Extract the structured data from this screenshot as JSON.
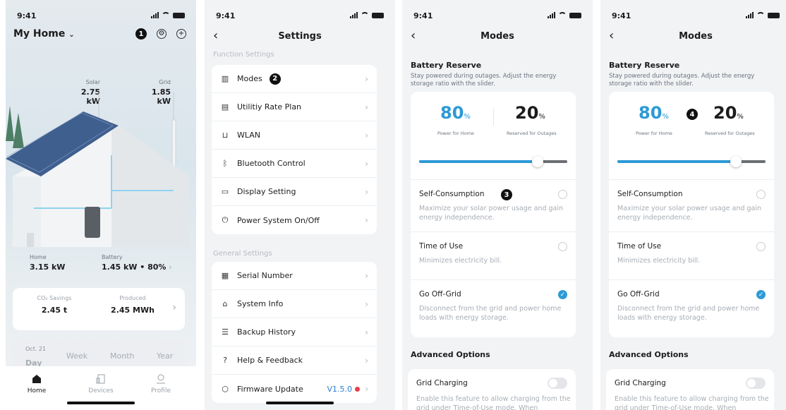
{
  "status": {
    "time": "9:41"
  },
  "home": {
    "title": "My Home",
    "badge": "1",
    "solar": {
      "label": "Solar",
      "value": "2.75 kW"
    },
    "grid": {
      "label": "Grid",
      "value": "1.85 kW"
    },
    "home_metric": {
      "label": "Home",
      "value": "3.15 kW"
    },
    "battery": {
      "label": "Battery",
      "value": "1.45 kW • 80%"
    },
    "co2": {
      "label": "CO₂ Savings",
      "value": "2.45 t"
    },
    "produced": {
      "label": "Produced",
      "value": "2.45 MWh"
    },
    "tabs": {
      "day": "Day",
      "date": "Oct. 21",
      "week": "Week",
      "month": "Month",
      "year": "Year"
    },
    "nav": {
      "home": "Home",
      "devices": "Devices",
      "profile": "Profile"
    }
  },
  "settings": {
    "title": "Settings",
    "function_label": "Function Settings",
    "general_label": "General Settings",
    "badge": "2",
    "function_items": [
      "Modes",
      "Utilitiy Rate Plan",
      "WLAN",
      "Bluetooth Control",
      "Display Setting",
      "Power System On/Off"
    ],
    "general_items": [
      "Serial Number",
      "System Info",
      "Backup History",
      "Help & Feedback",
      "Firmware Update"
    ],
    "firmware_version": "V1.5.0"
  },
  "modes": {
    "title": "Modes",
    "reserve_title": "Battery Reserve",
    "reserve_desc": "Stay powered during outages. Adjust the energy storage ratio with the slider.",
    "home_pct": "80",
    "reserve_pct": "20",
    "pct_unit": "%",
    "home_label": "Power for Home",
    "reserve_label": "Reserved for Outages",
    "slider_level": 0.8,
    "badge3": "3",
    "badge4": "4",
    "options": [
      {
        "title": "Self-Consumption",
        "desc": "Maximize your solar power usage and gain energy independence."
      },
      {
        "title": "Time of Use",
        "desc": "Minimizes electricity bill."
      },
      {
        "title": "Go Off-Grid",
        "desc": "Disconnect from the grid and power home loads with energy storage."
      }
    ],
    "advanced": "Advanced Options",
    "grid_charging": "Grid Charging",
    "grid_charging_desc": "Enable this feature to allow charging from the grid under Time-of-Use mode. When"
  },
  "colors": {
    "accent": "#2d9ad6",
    "alert": "#e8404a"
  }
}
